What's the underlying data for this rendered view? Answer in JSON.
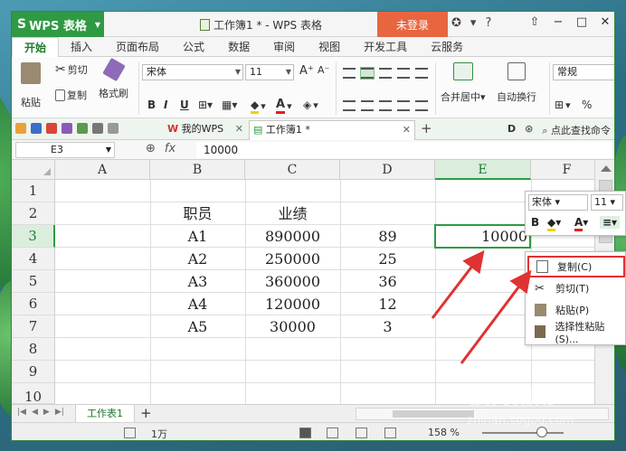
{
  "titlebar": {
    "app_name": "WPS 表格",
    "doc_title": "工作簿1 * - WPS 表格",
    "login": "未登录",
    "help": "?"
  },
  "ribbon_tabs": [
    "开始",
    "插入",
    "页面布局",
    "公式",
    "数据",
    "审阅",
    "视图",
    "开发工具",
    "云服务"
  ],
  "ribbon": {
    "paste": "粘贴",
    "cut": "剪切",
    "copy": "复制",
    "format_painter": "格式刷",
    "font_name": "宋体",
    "font_size": "11",
    "bold": "B",
    "italic": "I",
    "underline": "U",
    "merge_center": "合并居中",
    "wrap": "自动换行",
    "number_format": "常规",
    "percent": "%"
  },
  "quickbar": {
    "mywps_tab": "我的WPS",
    "doc_tab": "工作簿1 *",
    "find_cmd": "点此查找命令",
    "letter_d": "D"
  },
  "formula_bar": {
    "cell_ref": "E3",
    "fx": "fx",
    "value": "10000"
  },
  "grid": {
    "columns": [
      "A",
      "B",
      "C",
      "D",
      "E",
      "F"
    ],
    "selected_column": "E",
    "rows": [
      "1",
      "2",
      "3",
      "4",
      "5",
      "6",
      "7",
      "8",
      "9",
      "10"
    ],
    "selected_row": "3",
    "headers": {
      "b": "职员",
      "c": "业绩"
    },
    "data": [
      {
        "b": "A1",
        "c": "890000",
        "d": "89",
        "e": "10000"
      },
      {
        "b": "A2",
        "c": "250000",
        "d": "25",
        "e": ""
      },
      {
        "b": "A3",
        "c": "360000",
        "d": "36",
        "e": ""
      },
      {
        "b": "A4",
        "c": "120000",
        "d": "12",
        "e": ""
      },
      {
        "b": "A5",
        "c": "30000",
        "d": "3",
        "e": ""
      }
    ]
  },
  "sheetbar": {
    "sheet_name": "工作表1",
    "add": "+"
  },
  "status": {
    "count": "1万",
    "zoom": "158 %"
  },
  "mini_toolbar": {
    "font_name": "宋体",
    "font_size": "11",
    "bold": "B",
    "font_color": "A"
  },
  "context_menu": {
    "copy": "复制(C)",
    "cut": "剪切(T)",
    "paste": "粘贴(P)",
    "paste_special": "选择性粘贴(S)..."
  },
  "watermark": {
    "brand": "搜狗指南",
    "url": "zhinan.sogou.com"
  },
  "colors": {
    "accent": "#2f9a43",
    "login": "#e8663f",
    "arrow": "#e03232"
  }
}
